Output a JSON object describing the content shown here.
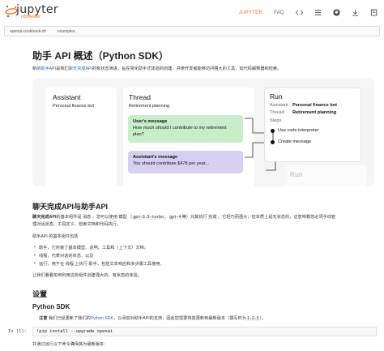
{
  "header": {
    "logo_text": "jupyter",
    "logo_sub": "nbviewer",
    "nav_jupyter": "JUPYTER",
    "nav_faq": "FAQ"
  },
  "breadcrumb": {
    "items": [
      "openai-cookbook-zh",
      "examples"
    ]
  },
  "page": {
    "title": "助手 API 概述（Python SDK）",
    "intro_pre": "新的",
    "intro_link1": "助手API",
    "intro_mid": "是我们",
    "intro_link2": "聊天完成API",
    "intro_post": "的有状态演进，旨在简化助手式体验的创建，并使开发者能够访问强大的工具，如代码解释器和检索。"
  },
  "diagram": {
    "assistant_title": "Assistant",
    "assistant_sub": "Personal finance bot",
    "thread_title": "Thread",
    "thread_sub": "Retirement planning",
    "user_msg_label": "User's message",
    "user_msg_text": "How much should I contribute to my retirement plan?",
    "assistant_msg_label": "Assistant's message",
    "assistant_msg_text": "You should contribute $478 per year...",
    "run_title": "Run",
    "run_assistant_key": "Assistant",
    "run_assistant_val": "Personal finance bot",
    "run_thread_key": "Thread",
    "run_thread_val": "Retirement planning",
    "run_steps_label": "Steps",
    "step1": "Use code interpreter",
    "step2": "Create message",
    "run2_title": "Run",
    "colors": {
      "user_msg": "#c8edc8",
      "assistant_msg": "#d6cff0"
    }
  },
  "section1": {
    "heading": "聊天完成API与助手API",
    "p1_bold": "聊天完成API",
    "p1_pre": "的基本组件是 消息 ，您可以使用 模型 （",
    "p1_code1": "gpt-3.5-turbo",
    "p1_mid": "、",
    "p1_code2": "gpt-4",
    "p1_post": "等）对其执行 完成 。它轻巧而强大，但本质上是无状态的，这意味着您必须手动管",
    "p1_line2": "理对话状态、工具定义、检索文档和代码执行。",
    "p2": "助手API 的基本组件包括",
    "bullets": [
      "助手，它封装了基本模型、说明、工具和（上下文）文档。",
      "线程，代表对话的状态，以及",
      "运行，用于在 线程 上执行 助手，包括文本响应和多步骤工具使用。"
    ],
    "p3": "让我们看看如何利用这些组件创建强大的、有状态的体验。"
  },
  "section2": {
    "heading": "设置",
    "subheading": "Python SDK",
    "note_bold": "注意",
    "note_pre": " 我们已经更新了我们的",
    "note_link": "Python SDK",
    "note_post": "，以添加对助手API的支持，因此您需要将其更新到最新版本（撰写时为",
    "note_code": "1.2.3",
    "note_end": "）。",
    "cell_prompt": "In [1]:",
    "cell_code": "!pip install --upgrade openai",
    "after_cell": "并通过运行以下命令确保其为最新版本："
  }
}
